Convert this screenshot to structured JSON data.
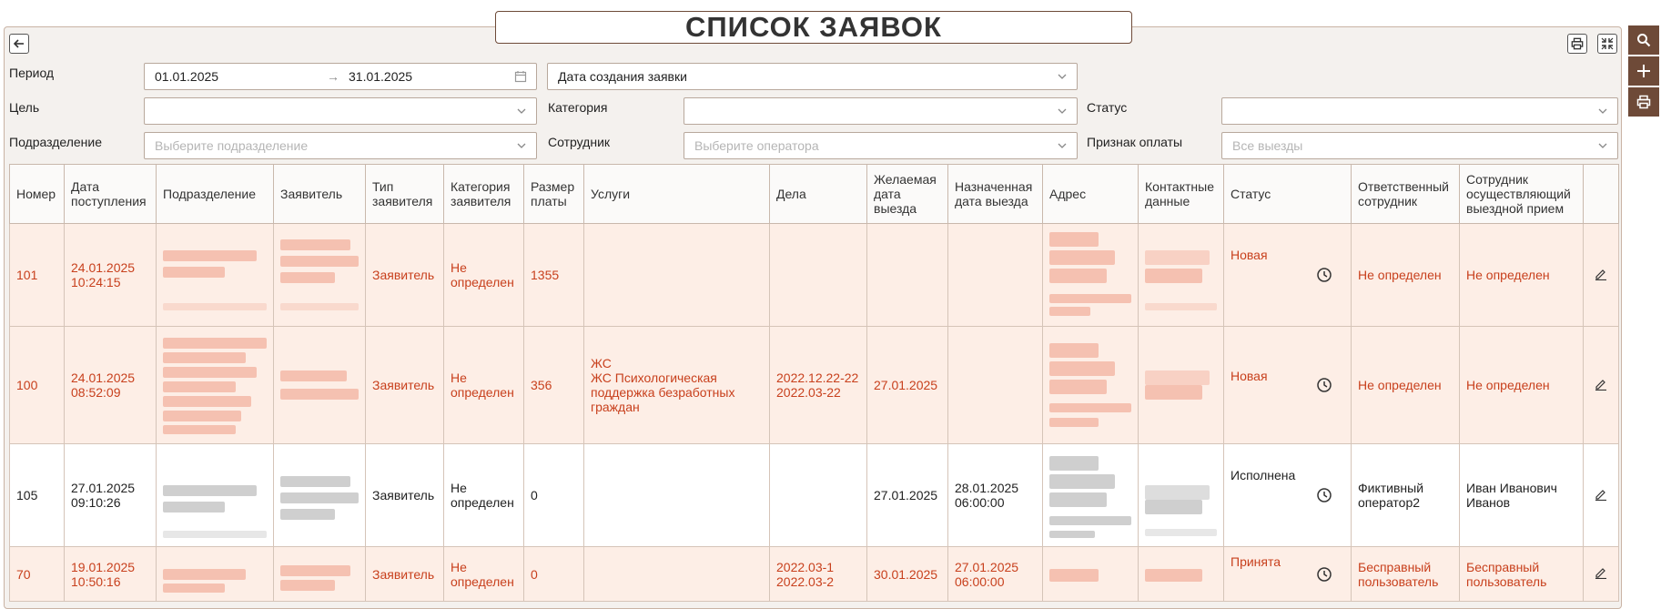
{
  "page": {
    "title": "СПИСОК ЗАЯВОК"
  },
  "filters": {
    "period_label": "Период",
    "date_from": "01.01.2025",
    "date_to": "31.01.2025",
    "date_type": "Дата создания заявки",
    "goal_label": "Цель",
    "goal_value": "",
    "category_label": "Категория",
    "category_value": "",
    "status_label": "Статус",
    "status_value": "",
    "division_label": "Подразделение",
    "division_placeholder": "Выберите подразделение",
    "employee_label": "Сотрудник",
    "employee_placeholder": "Выберите оператора",
    "payment_label": "Признак оплаты",
    "payment_placeholder": "Все выезды"
  },
  "table": {
    "headers": [
      "Номер",
      "Дата поступления",
      "Подразделение",
      "Заявитель",
      "Тип заявителя",
      "Категория заявителя",
      "Размер платы",
      "Услуги",
      "Дела",
      "Желаемая дата выезда",
      "Назначенная дата выезда",
      "Адрес",
      "Контактные данные",
      "Статус",
      "Ответственный сотрудник",
      "Сотрудник осуществляющий выездной прием",
      ""
    ],
    "rows": [
      {
        "number": "101",
        "date": "24.01.2025\n10:24:15",
        "type": "Заявитель",
        "category": "Не определен",
        "fee": "1355",
        "services": "",
        "cases": "",
        "wish_date": "",
        "assigned_date": "",
        "status": "Новая",
        "responsible": "Не определен",
        "field_employee": "Не определен"
      },
      {
        "number": "100",
        "date": "24.01.2025\n08:52:09",
        "type": "Заявитель",
        "category": "Не определен",
        "fee": "356",
        "services": "ЖС\nЖС Психологическая поддержка безработных граждан",
        "cases": "2022.12.22-22\n2022.03-22",
        "wish_date": "27.01.2025",
        "assigned_date": "",
        "status": "Новая",
        "responsible": "Не определен",
        "field_employee": "Не определен"
      },
      {
        "number": "105",
        "date": "27.01.2025\n09:10:26",
        "type": "Заявитель",
        "category": "Не определен",
        "fee": "0",
        "services": "",
        "cases": "",
        "wish_date": "27.01.2025",
        "assigned_date": "28.01.2025\n06:00:00",
        "status": "Исполнена",
        "responsible": "Фиктивный оператор2",
        "field_employee": "Иван Иванович Иванов"
      },
      {
        "number": "70",
        "date": "19.01.2025\n10:50:16",
        "type": "Заявитель",
        "category": "Не определен",
        "fee": "0",
        "services": "",
        "cases": "2022.03-1\n2022.03-2",
        "wish_date": "30.01.2025",
        "assigned_date": "27.01.2025\n06:00:00",
        "status": "Принята",
        "responsible": "Бесправный пользователь",
        "field_employee": "Бесправный пользователь"
      }
    ]
  },
  "icons": {
    "back": "arrow-left-icon",
    "print": "printer-icon",
    "fullscreen": "collapse-icon",
    "search": "search-icon",
    "add": "plus-icon",
    "calendar": "calendar-icon",
    "clock": "clock-icon",
    "edit": "pencil-icon"
  },
  "colors": {
    "brand": "#6e4a38",
    "highlight_text": "#c8401d",
    "highlight_bg": "#fdeee6"
  }
}
